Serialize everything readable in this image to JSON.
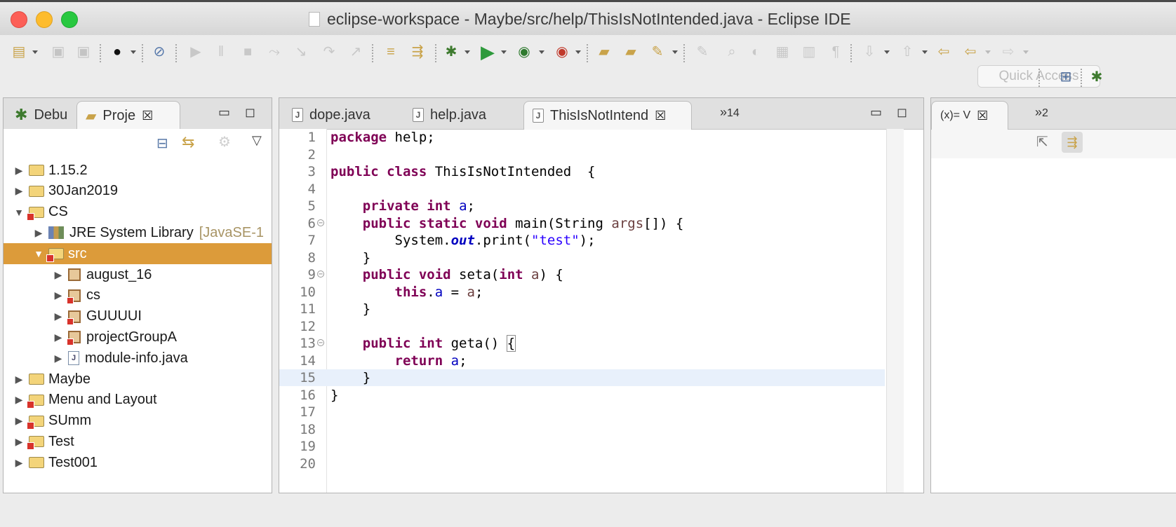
{
  "window": {
    "title": "eclipse-workspace - Maybe/src/help/ThisIsNotIntended.java - Eclipse IDE"
  },
  "toolbar": {
    "quick_access_placeholder": "Quick Access"
  },
  "left_pane": {
    "tabs": [
      {
        "label": "Debu",
        "icon": "bug-icon",
        "active": false
      },
      {
        "label": "Proje",
        "icon": "package-explorer-icon",
        "active": true
      }
    ],
    "tree": [
      {
        "label": "1.15.2",
        "indent": 0,
        "expanded": false,
        "type": "project",
        "error": false
      },
      {
        "label": "30Jan2019",
        "indent": 0,
        "expanded": false,
        "type": "project",
        "error": false
      },
      {
        "label": "CS",
        "indent": 0,
        "expanded": true,
        "type": "project",
        "error": true
      },
      {
        "label": "JRE System Library",
        "suffix": "[JavaSE-1",
        "indent": 1,
        "expanded": false,
        "type": "library",
        "error": false
      },
      {
        "label": "src",
        "indent": 1,
        "expanded": true,
        "type": "srcfolder",
        "error": true,
        "selected": true
      },
      {
        "label": "august_16",
        "indent": 2,
        "expanded": false,
        "type": "package",
        "error": false
      },
      {
        "label": "cs",
        "indent": 2,
        "expanded": false,
        "type": "package",
        "error": true
      },
      {
        "label": "GUUUUI",
        "indent": 2,
        "expanded": false,
        "type": "package",
        "error": true
      },
      {
        "label": "projectGroupA",
        "indent": 2,
        "expanded": false,
        "type": "package",
        "error": true
      },
      {
        "label": "module-info.java",
        "indent": 2,
        "expanded": false,
        "type": "javafile",
        "error": false
      },
      {
        "label": "Maybe",
        "indent": 0,
        "expanded": false,
        "type": "project",
        "error": false
      },
      {
        "label": "Menu and Layout",
        "indent": 0,
        "expanded": false,
        "type": "project",
        "error": true
      },
      {
        "label": "SUmm",
        "indent": 0,
        "expanded": false,
        "type": "project",
        "error": true
      },
      {
        "label": "Test",
        "indent": 0,
        "expanded": false,
        "type": "project",
        "error": true
      },
      {
        "label": "Test001",
        "indent": 0,
        "expanded": false,
        "type": "project",
        "error": false
      }
    ]
  },
  "editor": {
    "tabs": [
      {
        "label": "dope.java",
        "active": false
      },
      {
        "label": "help.java",
        "active": false
      },
      {
        "label": "ThisIsNotIntend",
        "active": true
      }
    ],
    "overflow_count": "14",
    "current_line": 15,
    "lines": [
      {
        "n": "1",
        "html": "<span class='kw'>package</span> help;"
      },
      {
        "n": "2",
        "html": ""
      },
      {
        "n": "3",
        "html": "<span class='kw'>public class</span> ThisIsNotIntended  {"
      },
      {
        "n": "4",
        "html": ""
      },
      {
        "n": "5",
        "html": "    <span class='kw'>private int</span> <span class='fld'>a</span>;"
      },
      {
        "n": "6",
        "fold": true,
        "html": "    <span class='kw'>public static void</span> main(String <span class='par'>args</span>[]) {"
      },
      {
        "n": "7",
        "html": "        System.<span class='sfld'>out</span>.print(<span class='str'>\"test\"</span>);"
      },
      {
        "n": "8",
        "html": "    }"
      },
      {
        "n": "9",
        "fold": true,
        "html": "    <span class='kw'>public void</span> seta(<span class='kw'>int</span> <span class='par'>a</span>) {"
      },
      {
        "n": "10",
        "html": "        <span class='kw'>this</span>.<span class='fld'>a</span> = <span class='par'>a</span>;"
      },
      {
        "n": "11",
        "html": "    }"
      },
      {
        "n": "12",
        "html": ""
      },
      {
        "n": "13",
        "fold": true,
        "html": "    <span class='kw'>public int</span> geta() <span class='brk'>{</span>"
      },
      {
        "n": "14",
        "html": "        <span class='kw'>return</span> <span class='fld'>a</span>;"
      },
      {
        "n": "15",
        "html": "    }"
      },
      {
        "n": "16",
        "html": "}"
      },
      {
        "n": "17",
        "html": ""
      },
      {
        "n": "18",
        "html": ""
      },
      {
        "n": "19",
        "html": ""
      },
      {
        "n": "20",
        "html": ""
      }
    ]
  },
  "right_pane": {
    "tab_label": "(x)= V",
    "overflow_count": "2"
  }
}
